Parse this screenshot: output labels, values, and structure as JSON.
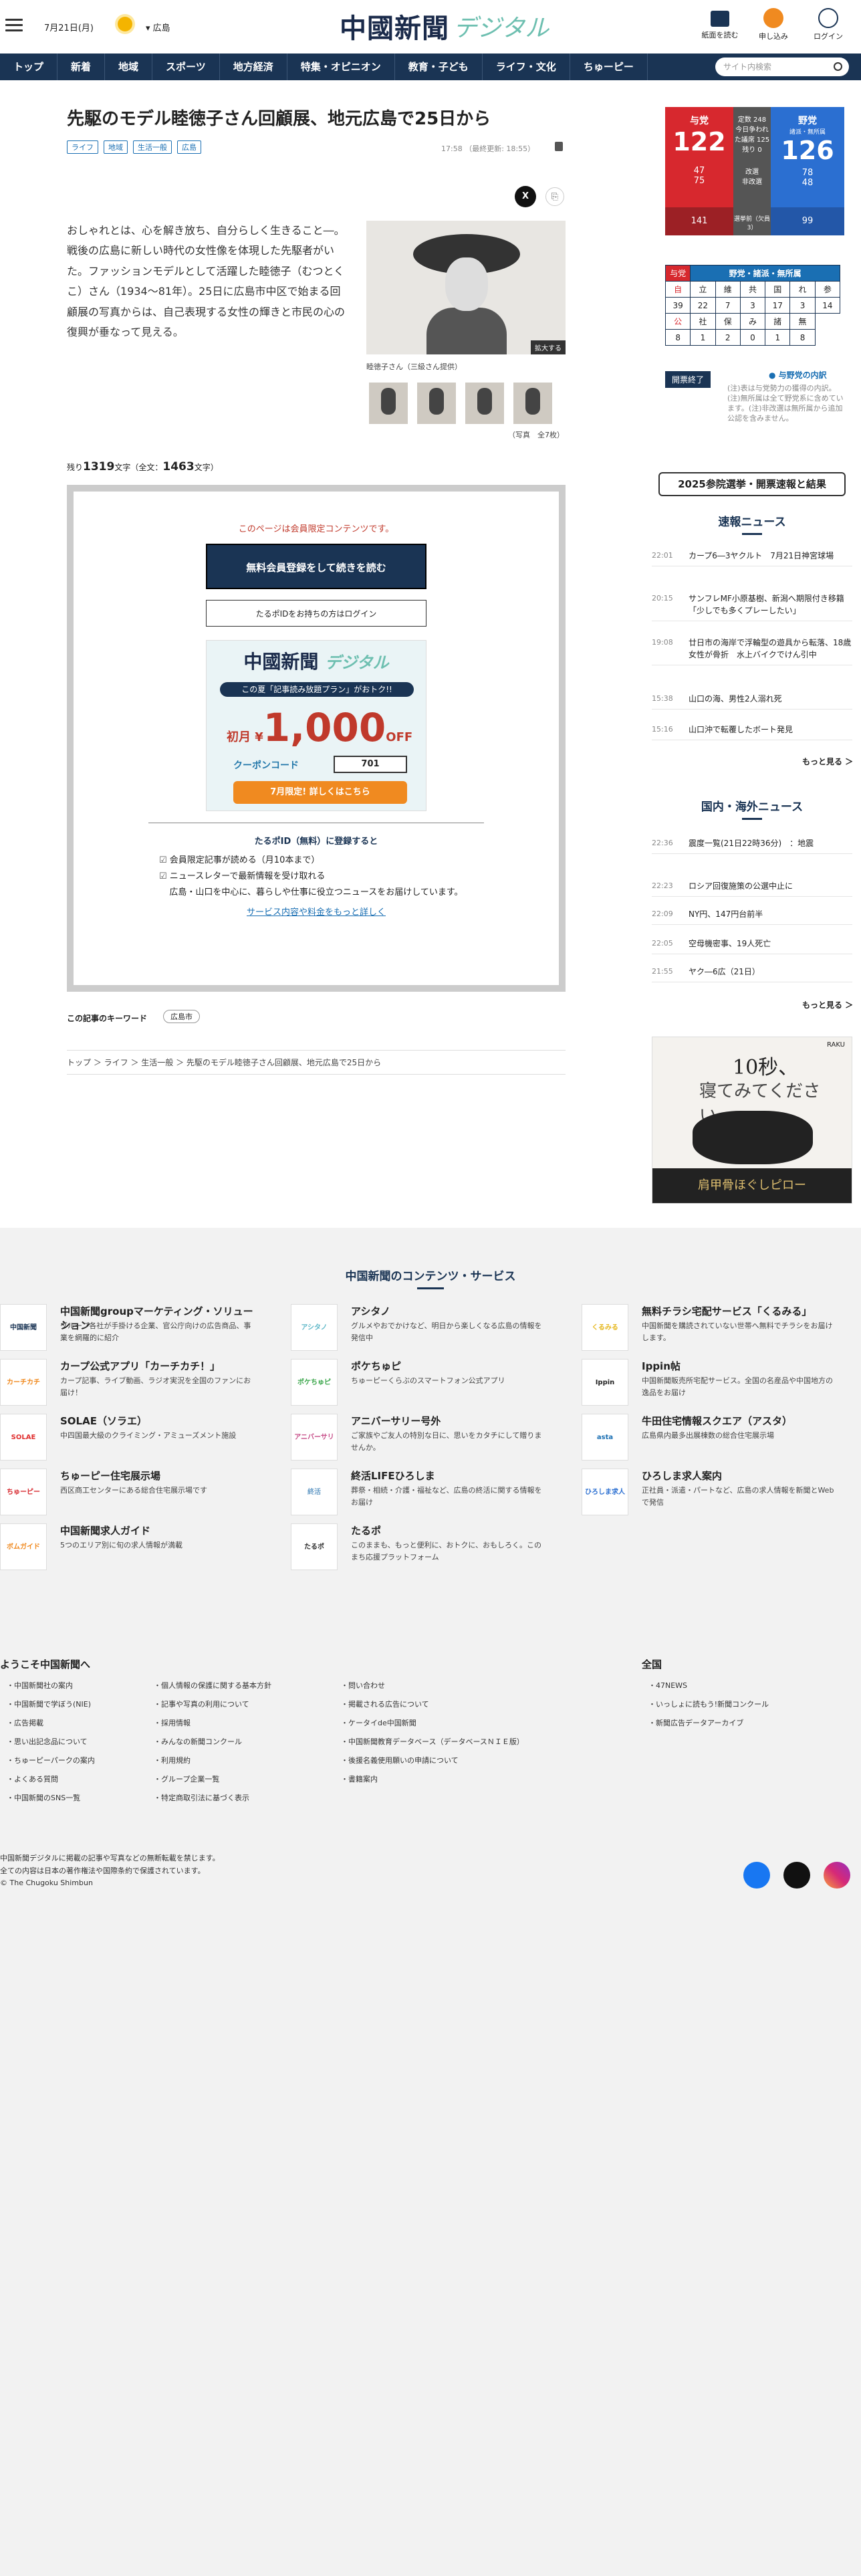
{
  "header": {
    "date": "7月21日(月)",
    "region": "広島",
    "logo_main": "中國新聞",
    "logo_sub": "デジタル",
    "btn_paper": "紙面を読む",
    "btn_subscribe": "申し込み",
    "btn_login": "ログイン"
  },
  "nav": {
    "items": [
      "トップ",
      "新着",
      "地域",
      "スポーツ",
      "地方経済",
      "特集・オピニオン",
      "教育・子ども",
      "ライフ・文化",
      "ちゅーピー"
    ],
    "search_placeholder": "サイト内検索"
  },
  "article": {
    "title": "先駆のモデル睦徳子さん回顧展、地元広島で25日から",
    "tags": [
      "ライフ",
      "地域",
      "生活一般",
      "広島"
    ],
    "time": "17:58 （最終更新: 18:55）",
    "body": "おしゃれとは、心を解き放ち、自分らしく生きること―。戦後の広島に新しい時代の女性像を体現した先駆者がいた。ファッションモデルとして活躍した睦徳子（むつとくこ）さん（1934～81年）。25日に広島市中区で始まる回顧展の写真からは、自己表現する女性の輝きと市民の心の復興が垂なって見える。",
    "photo_caption": "睦徳子さん（三級さん提供）",
    "zoom": "拡大する",
    "photo_count": "（写真　全7枚）",
    "remaining_pre": "残り",
    "remaining": "1319",
    "remaining_mid": "文字（全文：",
    "total": "1463",
    "remaining_post": "文字）"
  },
  "paywall": {
    "notice": "このページは会員限定コンテンツです。",
    "register": "無料会員登録をして続きを読む",
    "login": "たるポIDをお持ちの方はログイン",
    "banner_logo": "中國新聞",
    "banner_logo_sub": "デジタル",
    "banner_sub": "この夏「記事読み放題プラン」がおトク!!",
    "banner_first": "初月 ¥",
    "banner_amount": "1,000",
    "banner_off": "OFF",
    "coupon_label": "クーポンコード",
    "coupon": "701",
    "banner_go": "7月限定! 詳しくはこちら",
    "id_title": "たるポID（無料）に登録すると",
    "perk1": "会員限定記事が読める（月10本まで）",
    "perk2": "ニュースレターで最新情報を受け取れる",
    "local": "広島・山口を中心に、暮らしや仕事に役立つニュースをお届けしています。",
    "services": "サービス内容や料金をもっと詳しく"
  },
  "keywords": {
    "label": "この記事のキーワード",
    "tag": "広島市"
  },
  "breadcrumb": "トップ ＞ ライフ ＞ 生活一般 ＞ 先駆のモデル睦徳子さん回顧展、地元広島で25日から",
  "election": {
    "ruling": "与党",
    "ruling_total": "122",
    "opposition": "野党",
    "opposition_sub": "諸派・無所属",
    "opposition_total": "126",
    "center_l1": "定数 248",
    "center_l2": "今日争われた議席 125",
    "center_l3": "残り 0",
    "r_elected": "47",
    "r_hold": "75",
    "o_elected": "78",
    "o_hold": "48",
    "row1": "改選",
    "row2": "非改選",
    "r_after": "141",
    "o_after": "99",
    "row3": "選挙前（欠員3）",
    "table_header": "野党・諸派・無所属",
    "table_row1": [
      "自",
      "立",
      "維",
      "共",
      "国",
      "れ",
      "参"
    ],
    "table_row2": [
      "39",
      "22",
      "7",
      "3",
      "17",
      "3",
      "14"
    ],
    "table_row3": [
      "公",
      "社",
      "保",
      "み",
      "諸",
      "無"
    ],
    "table_row4": [
      "8",
      "1",
      "2",
      "0",
      "1",
      "8"
    ],
    "counted": "開票終了",
    "legend": "与野党の内訳",
    "notes": "(注)表は与党勢力の獲得の内訳。(注)無所属は全て野党系に含めています。(注)非改選は無所属から追加公認を含みません。",
    "results_btn": "2025参院選挙・開票速報と結果"
  },
  "breaking": {
    "title": "速報ニュース",
    "items": [
      {
        "t": "22:01",
        "h": "カープ6―3ヤクルト　7月21日神宮球場"
      },
      {
        "t": "20:15",
        "h": "サンフレMF小原基樹、新潟へ期限付き移籍「少しでも多くプレーしたい」"
      },
      {
        "t": "19:08",
        "h": "廿日市の海岸で浮輪型の遊具から転落、18歳女性が骨折　水上バイクでけん引中"
      },
      {
        "t": "15:38",
        "h": "山口の海、男性2人溺れ死"
      },
      {
        "t": "15:16",
        "h": "山口沖で転覆したボート発見"
      }
    ],
    "more": "もっと見る ＞"
  },
  "world": {
    "title": "国内・海外ニュース",
    "items": [
      {
        "t": "22:36",
        "h": "震度一覧(21日22時36分)　：地震"
      },
      {
        "t": "22:23",
        "h": "ロシア回復施策の公選中止に"
      },
      {
        "t": "22:09",
        "h": "NY円、147円台前半"
      },
      {
        "t": "22:05",
        "h": "空母機密事、19人死亡"
      },
      {
        "t": "21:55",
        "h": "ヤク―6広（21日）"
      }
    ],
    "more": "もっと見る ＞"
  },
  "ad": {
    "brand": "RAKU",
    "big": "10秒、",
    "s1": "寝てみてください。",
    "bar": "肩甲骨ほぐしピロー"
  },
  "footer": {
    "title": "中国新聞のコンテンツ・サービス",
    "services": [
      {
        "ic": "中国新聞group",
        "nm": "中国新聞groupマーケティング・ソリューション",
        "ds": "グループ各社が手掛ける企業、官公庁向けの広告商品、事業を網羅的に紹介"
      },
      {
        "ic": "アシタノ",
        "nm": "アシタノ",
        "ds": "グルメやおでかけなど、明日から楽しくなる広島の情報を発信中"
      },
      {
        "ic": "くるみる",
        "nm": "無料チラシ宅配サービス「くるみる」",
        "ds": "中国新聞を購読されていない世帯へ無料でチラシをお届けします。"
      },
      {
        "ic": "カーチカチ",
        "nm": "カープ公式アプリ「カーチカチ！」",
        "ds": "カープ記事、ライブ動画、ラジオ実況を全国のファンにお届け！"
      },
      {
        "ic": "ポケちゅピ",
        "nm": "ポケちゅピ",
        "ds": "ちゅーピーくらぶのスマートフォン公式アプリ"
      },
      {
        "ic": "Ippin",
        "nm": "Ippin帖",
        "ds": "中国新聞販売所宅配サービス。全国の名産品や中国地方の逸品をお届け"
      },
      {
        "ic": "SOLAE",
        "nm": "SOLAE（ソラエ）",
        "ds": "中四国最大級のクライミング・アミューズメント施設"
      },
      {
        "ic": "アニバーサリー",
        "nm": "アニバーサリー号外",
        "ds": "ご家族やご友人の特別な日に、思いをカタチにして贈りませんか。"
      },
      {
        "ic": "asta",
        "nm": "牛田住宅情報スクエア（アスタ）",
        "ds": "広島県内最多出展棟数の総合住宅展示場"
      },
      {
        "ic": "ちゅーピー",
        "nm": "ちゅーピー住宅展示場",
        "ds": "西区商工センターにある総合住宅展示場です"
      },
      {
        "ic": "終活",
        "nm": "終活LIFEひろしま",
        "ds": "葬祭・相続・介護・福祉など、広島の終活に関する情報をお届け"
      },
      {
        "ic": "ひろしま求人",
        "nm": "ひろしま求人案内",
        "ds": "正社員・派遣・パートなど、広島の求人情報を新聞とWebで発信"
      },
      {
        "ic": "ボムガイド",
        "nm": "中国新聞求人ガイド",
        "ds": "5つのエリア別に旬の求人情報が満載"
      },
      {
        "ic": "たるポ",
        "nm": "たるポ",
        "ds": "このままも、もっと便利に、おトクに、おもしろく。このまち応援プラットフォーム"
      }
    ],
    "welcome": "ようこそ中国新聞へ",
    "col1": [
      "中国新聞社の案内",
      "中国新聞で学ぼう(NIE)",
      "広告掲載",
      "思い出記念品について",
      "ちゅーピーパークの案内",
      "よくある質問",
      "中国新聞のSNS一覧"
    ],
    "col2": [
      "個人情報の保護に関する基本方針",
      "記事や写真の利用について",
      "採用情報",
      "みんなの新聞コンクール",
      "利用規約",
      "グループ企業一覧",
      "特定商取引法に基づく表示"
    ],
    "col3": [
      "問い合わせ",
      "掲載される広告について",
      "ケータイde中国新聞",
      "中国新聞教育データベース（データベースＮＩＥ版）",
      "後援名義使用願いの申請について",
      "書籍案内"
    ],
    "national": "全国",
    "col4": [
      "47NEWS",
      "いっしょに読もう!新聞コンクール",
      "新聞広告データアーカイブ"
    ],
    "copy1": "中国新聞デジタルに掲載の記事や写真などの無断転載を禁じます。",
    "copy2": "全ての内容は日本の著作権法や国際条約で保護されています。",
    "copy3": "© The Chugoku Shimbun"
  }
}
